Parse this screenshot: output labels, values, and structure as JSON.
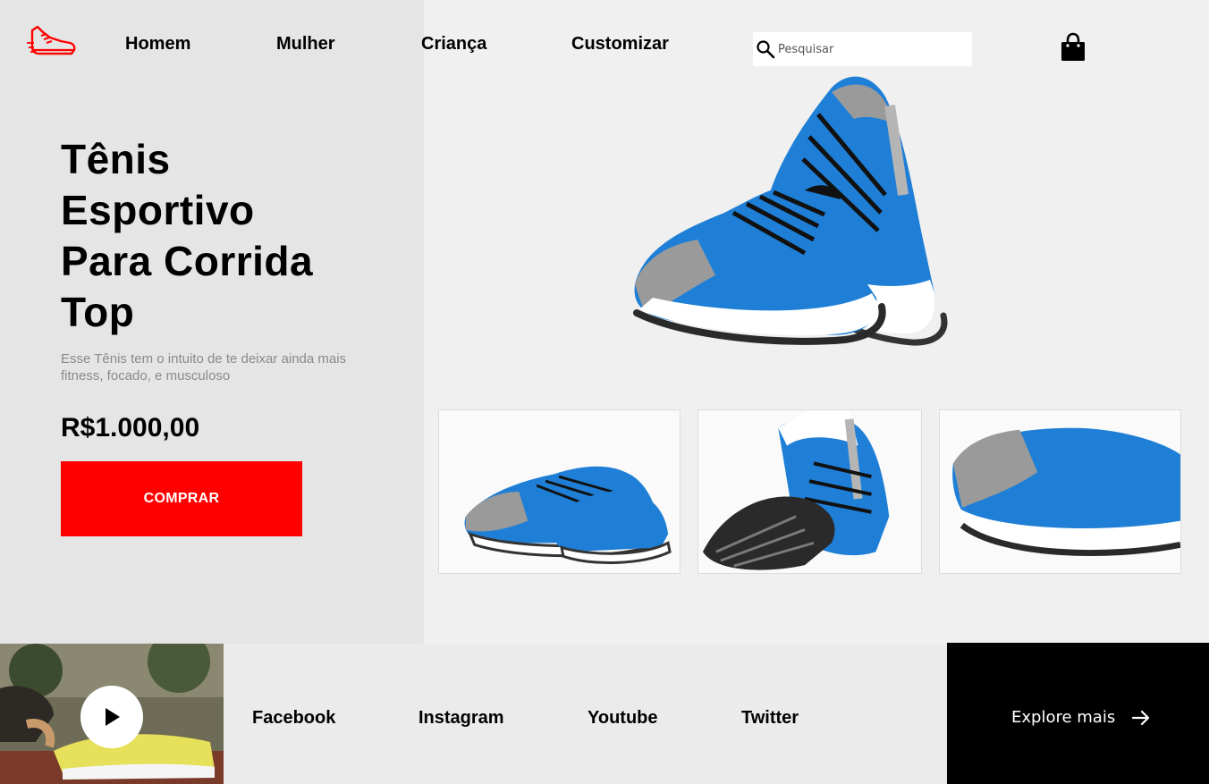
{
  "nav": {
    "items": [
      {
        "label": "Homem"
      },
      {
        "label": "Mulher"
      },
      {
        "label": "Criança"
      },
      {
        "label": "Customizar"
      }
    ]
  },
  "search": {
    "placeholder": "Pesquisar",
    "icon": "search-icon"
  },
  "cart": {
    "icon": "shopping-bag-icon"
  },
  "logo": {
    "icon": "running-shoe-logo-icon",
    "color": "#ff0000"
  },
  "product": {
    "title_lines": [
      "Tênis",
      "Esportivo",
      "Para Corrida",
      "Top"
    ],
    "description": "Esse Tênis tem o intuito de te deixar ainda mais fitness, focado, e musculoso",
    "price": "R$1.000,00",
    "buy_label": "COMPRAR"
  },
  "gallery": {
    "main_image": "blue-running-shoes-pair",
    "thumbnails": [
      "shoes-side-view",
      "shoes-sole-view",
      "shoe-closeup"
    ]
  },
  "footer": {
    "video_icon": "play-icon",
    "social": [
      "Facebook",
      "Instagram",
      "Youtube",
      "Twitter"
    ],
    "explore_label": "Explore mais",
    "explore_icon": "arrow-right-icon"
  },
  "colors": {
    "accent": "#ff0000",
    "shoe_blue": "#1f7fd6",
    "left_panel": "#e5e5e5",
    "page_bg": "#f0f0f0",
    "footer_dark": "#000000"
  }
}
